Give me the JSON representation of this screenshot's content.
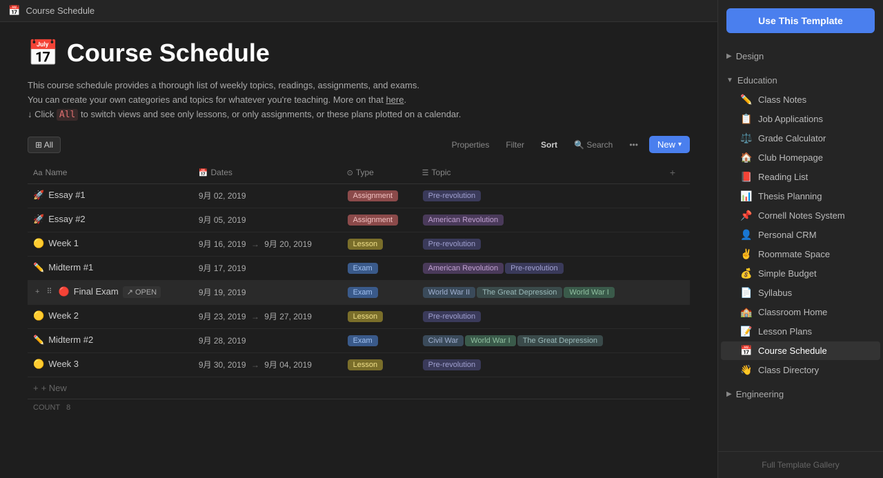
{
  "titlebar": {
    "icon": "📅",
    "text": "Course Schedule"
  },
  "page": {
    "title": "Course Schedule",
    "title_icon": "📅",
    "description_line1": "This course schedule provides a thorough list of weekly topics, readings, assignments, and exams.",
    "description_line2": "You can create your own categories and topics for whatever you're teaching. More on that",
    "description_link": "here",
    "description_line3": "↓ Click",
    "description_highlight": "All",
    "description_line4": "to switch views and see only lessons, or only assignments, or these plans plotted on a calendar."
  },
  "toolbar": {
    "view_label": "⊞ All",
    "properties": "Properties",
    "filter": "Filter",
    "sort": "Sort",
    "search_icon": "🔍",
    "search_label": "Search",
    "more": "•••",
    "new_label": "New",
    "new_arrow": "▾"
  },
  "table": {
    "columns": [
      {
        "icon": "Aa",
        "label": "Name"
      },
      {
        "icon": "📅",
        "label": "Dates"
      },
      {
        "icon": "⊙",
        "label": "Type"
      },
      {
        "icon": "☰",
        "label": "Topic"
      }
    ],
    "rows": [
      {
        "icon": "🚀",
        "name": "Essay #1",
        "dates": "9月 02, 2019",
        "dates_end": "",
        "type": "Assignment",
        "type_class": "assignment",
        "topics": [
          {
            "label": "Pre-revolution",
            "class": ""
          }
        ]
      },
      {
        "icon": "🚀",
        "name": "Essay #2",
        "dates": "9月 05, 2019",
        "dates_end": "",
        "type": "Assignment",
        "type_class": "assignment",
        "topics": [
          {
            "label": "American Revolution",
            "class": "american"
          }
        ]
      },
      {
        "icon": "🟡",
        "name": "Week 1",
        "dates": "9月 16, 2019",
        "dates_end": "9月 20, 2019",
        "type": "Lesson",
        "type_class": "lesson",
        "topics": [
          {
            "label": "Pre-revolution",
            "class": ""
          }
        ]
      },
      {
        "icon": "✏️",
        "name": "Midterm #1",
        "dates": "9月 17, 2019",
        "dates_end": "",
        "type": "Exam",
        "type_class": "exam",
        "topics": [
          {
            "label": "American Revolution",
            "class": "american"
          },
          {
            "label": "Pre-revolution",
            "class": ""
          }
        ]
      },
      {
        "icon": "🔴",
        "name": "Final Exam",
        "dates": "9月 19, 2019",
        "dates_end": "",
        "type": "Exam",
        "type_class": "exam",
        "topics": [
          {
            "label": "World War II",
            "class": "wwii"
          },
          {
            "label": "The Great Depression",
            "class": "depression"
          },
          {
            "label": "World War I",
            "class": "wwi"
          }
        ],
        "highlighted": true,
        "open_label": "OPEN"
      },
      {
        "icon": "🟡",
        "name": "Week 2",
        "dates": "9月 23, 2019",
        "dates_end": "9月 27, 2019",
        "type": "Lesson",
        "type_class": "lesson",
        "topics": [
          {
            "label": "Pre-revolution",
            "class": ""
          }
        ]
      },
      {
        "icon": "✏️",
        "name": "Midterm #2",
        "dates": "9月 28, 2019",
        "dates_end": "",
        "type": "Exam",
        "type_class": "exam",
        "topics": [
          {
            "label": "Civil War",
            "class": "civil"
          },
          {
            "label": "World War I",
            "class": "wwi"
          },
          {
            "label": "The Great Depression",
            "class": "depression"
          }
        ]
      },
      {
        "icon": "🟡",
        "name": "Week 3",
        "dates": "9月 30, 2019",
        "dates_end": "9月 04, 2019",
        "type": "Lesson",
        "type_class": "lesson",
        "topics": [
          {
            "label": "Pre-revolution",
            "class": ""
          }
        ]
      }
    ],
    "add_row_label": "+ New",
    "count_label": "COUNT",
    "count_value": "8"
  },
  "sidebar": {
    "use_template_label": "Use This Template",
    "sections": [
      {
        "label": "Design",
        "expanded": false,
        "items": []
      },
      {
        "label": "Education",
        "expanded": true,
        "items": [
          {
            "icon": "✏️",
            "label": "Class Notes"
          },
          {
            "icon": "📋",
            "label": "Job Applications"
          },
          {
            "icon": "⚖️",
            "label": "Grade Calculator"
          },
          {
            "icon": "🏠",
            "label": "Club Homepage"
          },
          {
            "icon": "📕",
            "label": "Reading List"
          },
          {
            "icon": "📊",
            "label": "Thesis Planning"
          },
          {
            "icon": "📌",
            "label": "Cornell Notes System"
          },
          {
            "icon": "👤",
            "label": "Personal CRM"
          },
          {
            "icon": "✌️",
            "label": "Roommate Space"
          },
          {
            "icon": "💰",
            "label": "Simple Budget"
          },
          {
            "icon": "📄",
            "label": "Syllabus"
          },
          {
            "icon": "🏫",
            "label": "Classroom Home"
          },
          {
            "icon": "📝",
            "label": "Lesson Plans"
          },
          {
            "icon": "📅",
            "label": "Course Schedule",
            "active": true
          },
          {
            "icon": "👋",
            "label": "Class Directory"
          }
        ]
      },
      {
        "label": "Engineering",
        "expanded": false,
        "items": []
      }
    ],
    "footer_label": "Full Template Gallery"
  }
}
